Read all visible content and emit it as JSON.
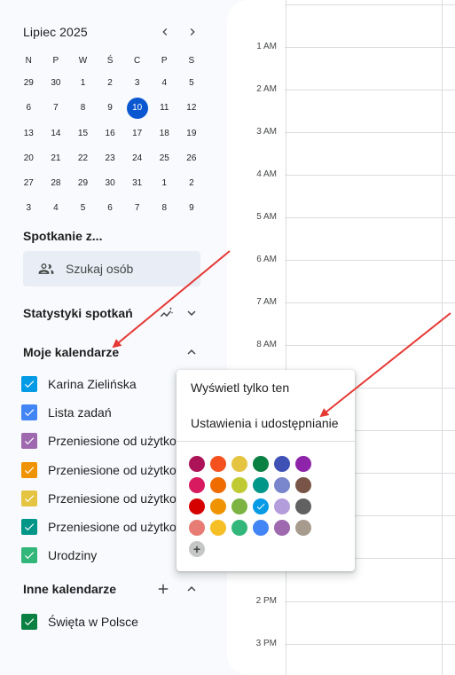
{
  "mini_calendar": {
    "month_label": "Lipiec 2025",
    "weekday_headers": [
      "N",
      "P",
      "W",
      "Ś",
      "C",
      "P",
      "S"
    ],
    "weeks": [
      [
        "29",
        "30",
        "1",
        "2",
        "3",
        "4",
        "5"
      ],
      [
        "6",
        "7",
        "8",
        "9",
        "10",
        "11",
        "12"
      ],
      [
        "13",
        "14",
        "15",
        "16",
        "17",
        "18",
        "19"
      ],
      [
        "20",
        "21",
        "22",
        "23",
        "24",
        "25",
        "26"
      ],
      [
        "27",
        "28",
        "29",
        "30",
        "31",
        "1",
        "2"
      ],
      [
        "3",
        "4",
        "5",
        "6",
        "7",
        "8",
        "9"
      ]
    ],
    "today": "10",
    "today_color": "#0b57d0",
    "prev_icon": "chevron-left-icon",
    "next_icon": "chevron-right-icon"
  },
  "meet": {
    "title": "Spotkanie z...",
    "search_label": "Szukaj osób",
    "search_icon": "people-icon"
  },
  "stats": {
    "title": "Statystyki spotkań"
  },
  "my_calendars": {
    "title": "Moje kalendarze",
    "items": [
      {
        "name": "Karina Zielińska",
        "color": "#039be5"
      },
      {
        "name": "Lista zadań",
        "color": "#4285f4"
      },
      {
        "name": "Przeniesione od użytkownika",
        "color": "#9e69af"
      },
      {
        "name": "Przeniesione od użytkownika",
        "color": "#f09300"
      },
      {
        "name": "Przeniesione od użytkownika",
        "color": "#e4c441"
      },
      {
        "name": "Przeniesione od użytkownika",
        "color": "#009688"
      },
      {
        "name": "Urodziny",
        "color": "#33b679"
      }
    ]
  },
  "other_calendars": {
    "title": "Inne kalendarze",
    "items": [
      {
        "name": "Święta w Polsce",
        "color": "#0b8043"
      }
    ]
  },
  "time_grid": {
    "hours_top": [
      "1 AM",
      "2 AM",
      "3 AM",
      "4 AM",
      "5 AM",
      "6 AM",
      "7 AM",
      "8 AM"
    ],
    "hours_bottom": [
      "2 PM",
      "3 PM"
    ]
  },
  "popup_menu": {
    "items": [
      "Wyświetl tylko ten",
      "Ustawienia i udostępnianie"
    ],
    "selected_color": "#039be5",
    "color_rows": [
      [
        "#ad1457",
        "#f4511e",
        "#e4c441",
        "#0b8043",
        "#3f51b5",
        "#8e24aa"
      ],
      [
        "#d81b60",
        "#ef6c00",
        "#c0ca33",
        "#009688",
        "#7986cb",
        "#795548"
      ],
      [
        "#d50000",
        "#f09300",
        "#7cb342",
        "#039be5",
        "#b39ddb",
        "#616161"
      ],
      [
        "#e67c73",
        "#f6bf26",
        "#33b679",
        "#4285f4",
        "#9e69af",
        "#a79b8e"
      ]
    ],
    "add_label": "+"
  },
  "annotation_color": "#e53935"
}
